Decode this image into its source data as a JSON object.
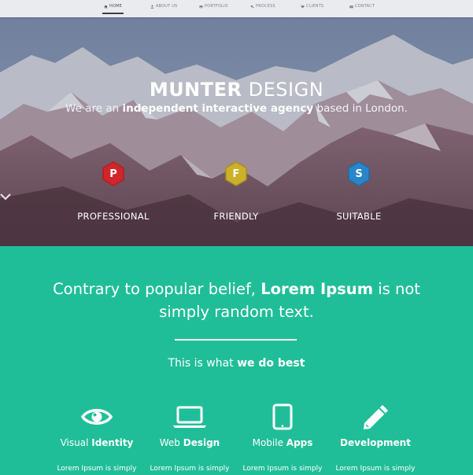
{
  "nav": {
    "items": [
      {
        "label": "HOME",
        "icon": "home-icon",
        "active": true
      },
      {
        "label": "ABOUT US",
        "icon": "user-icon",
        "active": false
      },
      {
        "label": "PORTFOLIO",
        "icon": "image-icon",
        "active": false
      },
      {
        "label": "PROCESS",
        "icon": "gears-icon",
        "active": false
      },
      {
        "label": "CLIENTS",
        "icon": "heart-icon",
        "active": false
      },
      {
        "label": "CONTACT",
        "icon": "envelope-icon",
        "active": false
      }
    ]
  },
  "hero": {
    "title_bold": "MUNTER",
    "title_light": "DESIGN",
    "sub_pre": "We are an ",
    "sub_bold": "independent interactive agency",
    "sub_post": " based in London.",
    "features": [
      {
        "letter": "P",
        "label": "PROFESSIONAL",
        "color": "#d0262b"
      },
      {
        "letter": "F",
        "label": "FRIENDLY",
        "color": "#cbb129"
      },
      {
        "letter": "S",
        "label": "SUITABLE",
        "color": "#2a86c9"
      }
    ]
  },
  "intro": {
    "quote_pre": "Contrary to popular belief, ",
    "quote_bold": "Lorem Ipsum",
    "quote_post": " is not simply random text.",
    "best_pre": "This is what ",
    "best_bold": "we do best"
  },
  "services": [
    {
      "icon": "eye-icon",
      "title_light": "Visual ",
      "title_bold": "Identity",
      "text": "Lorem Ipsum is simply"
    },
    {
      "icon": "laptop-icon",
      "title_light": "Web ",
      "title_bold": "Design",
      "text": "Lorem Ipsum is simply"
    },
    {
      "icon": "tablet-icon",
      "title_light": "Mobile ",
      "title_bold": "Apps",
      "text": "Lorem Ipsum is simply"
    },
    {
      "icon": "pencil-icon",
      "title_light": "",
      "title_bold": "Development",
      "text": "Lorem Ipsum is simply"
    }
  ],
  "colors": {
    "accent_green": "#20be98",
    "nav_bg": "#e9ebee"
  }
}
